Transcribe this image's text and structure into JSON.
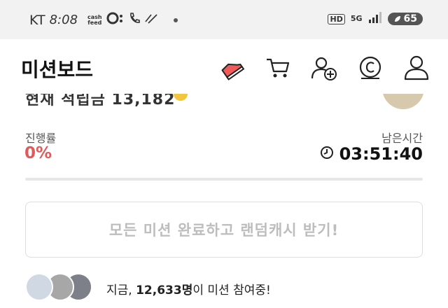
{
  "status_bar": {
    "carrier": "KT",
    "time": "8:08",
    "cashfeed_label": "cash\nfeed",
    "network": "5G",
    "hd_label": "HD",
    "battery": "65",
    "icons": [
      "cashfeed-icon",
      "whowho-icon",
      "call-icon",
      "signal-icon",
      "battery-icon"
    ]
  },
  "header": {
    "title": "미션보드",
    "icons": [
      "sneaker-icon",
      "cart-icon",
      "add-user-icon",
      "coin-icon",
      "profile-icon"
    ]
  },
  "partial_row": {
    "text": "현재 적립금 13,182"
  },
  "progress": {
    "label": "진행률",
    "value": "0%"
  },
  "remaining": {
    "label": "남은시간",
    "time": "03:51:40"
  },
  "reward_button": {
    "label": "모든 미션 완료하고 랜덤캐시 받기!"
  },
  "participants": {
    "prefix": "지금, ",
    "count": "12,633명",
    "suffix": "이 미션 참여중!"
  },
  "colors": {
    "accent_red": "#e05a5a",
    "disabled_text": "#bdbdbd",
    "status_bar_bg": "#f2f2f2"
  }
}
